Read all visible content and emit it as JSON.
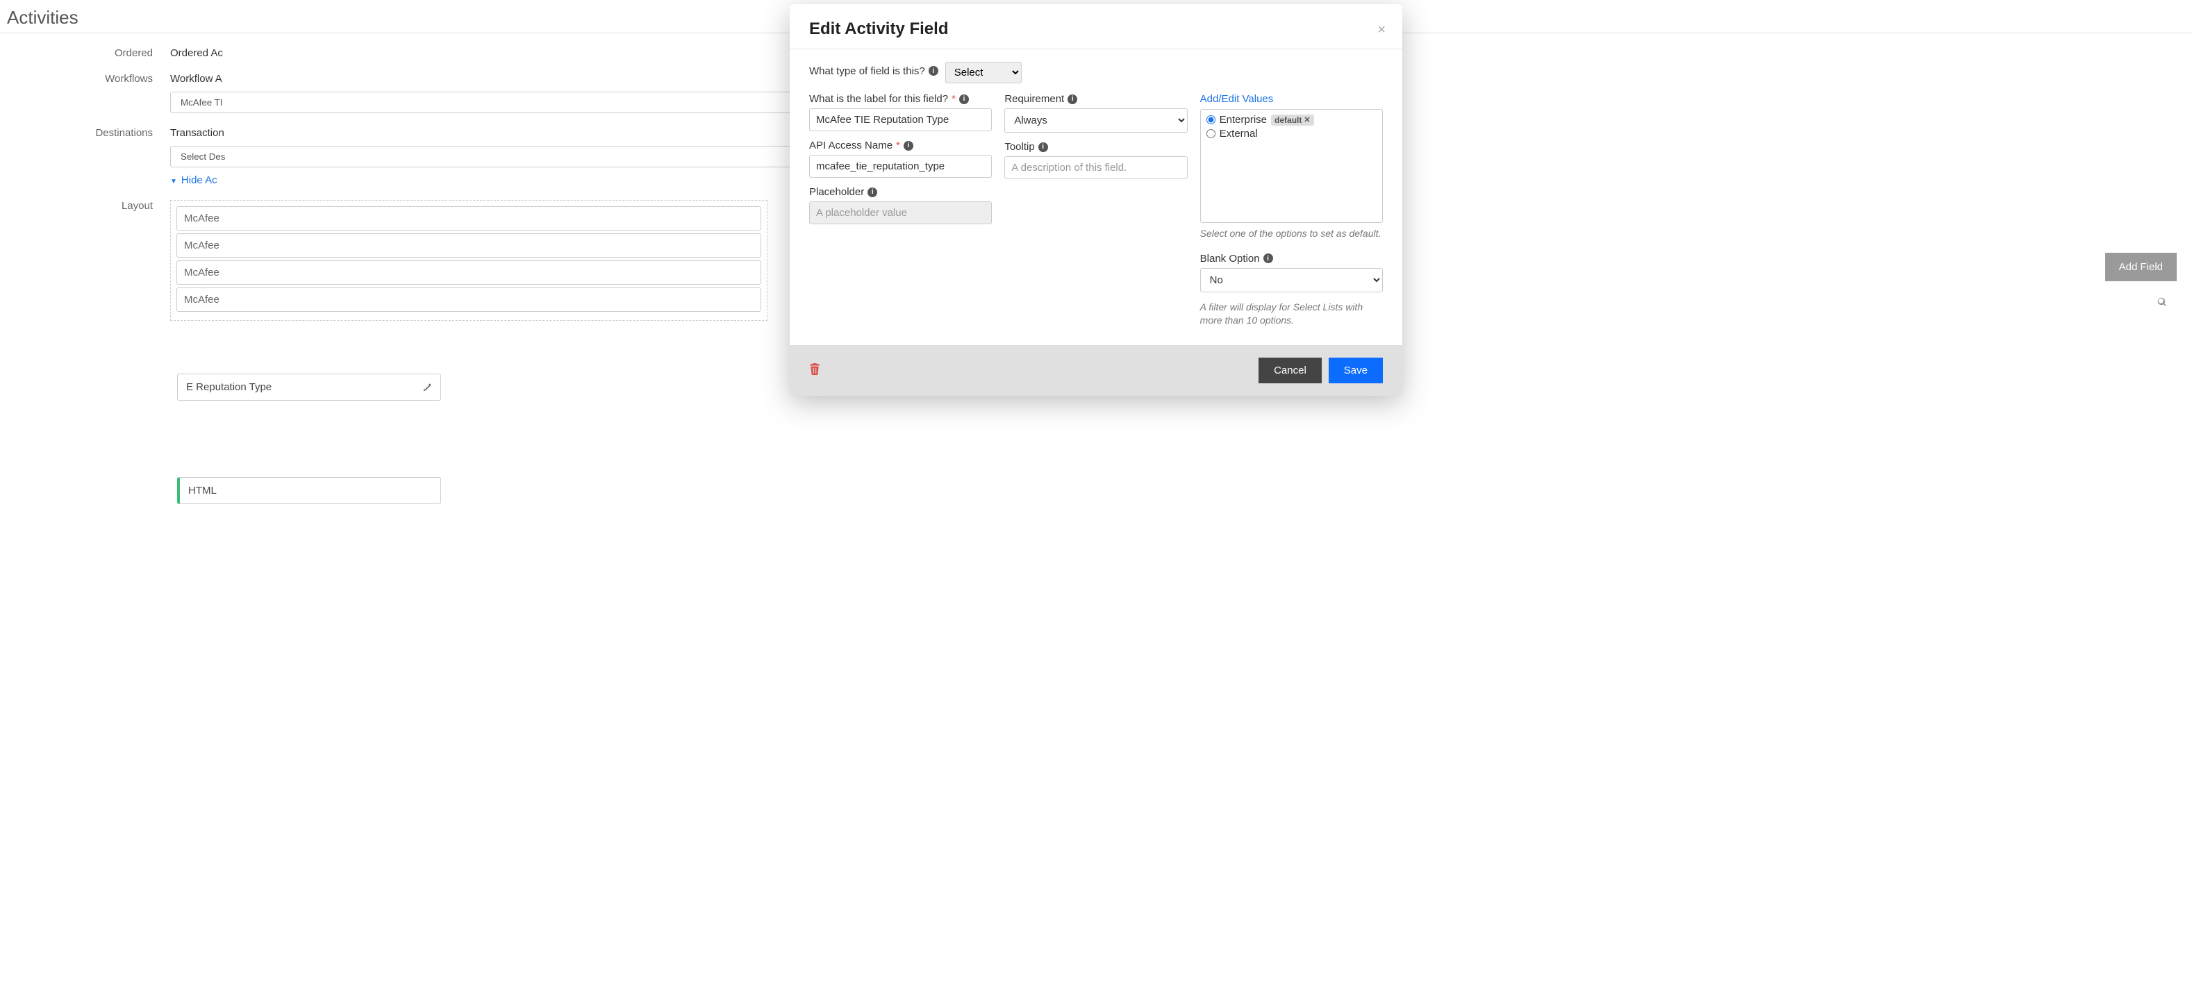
{
  "pageTitle": "Activities",
  "sidebar": {
    "ordered": "Ordered",
    "workflows": "Workflows",
    "destinations": "Destinations",
    "layout": "Layout"
  },
  "bg": {
    "orderedLabel": "Ordered Ac",
    "workflowLabel": "Workflow A",
    "select1": "McAfee TI",
    "destinationsRow": "Transaction",
    "select2": "Select Des",
    "hideLink": "Hide Ac",
    "addFieldBtn": "Add Field",
    "layoutRows": [
      "McAfee",
      "McAfee",
      "McAfee",
      "McAfee"
    ],
    "rightChip": "E Reputation Type",
    "htmlChip": "HTML"
  },
  "modal": {
    "title": "Edit Activity Field",
    "fieldTypeLabel": "What type of field is this?",
    "fieldTypeValue": "Select",
    "labelQuestion": "What is the label for this field?",
    "labelValue": "McAfee TIE Reputation Type",
    "apiNameLabel": "API Access Name",
    "apiNameValue": "mcafee_tie_reputation_type",
    "placeholderLabel": "Placeholder",
    "placeholderValue": "A placeholder value",
    "requirementLabel": "Requirement",
    "requirementValue": "Always",
    "tooltipLabel": "Tooltip",
    "tooltipPlaceholder": "A description of this field.",
    "addEditValues": "Add/Edit Values",
    "values": [
      {
        "label": "Enterprise",
        "selected": true,
        "default": true
      },
      {
        "label": "External",
        "selected": false,
        "default": false
      }
    ],
    "defaultTag": "default",
    "valuesHint": "Select one of the options to set as default.",
    "blankOptionLabel": "Blank Option",
    "blankOptionValue": "No",
    "blankOptionHint": "A filter will display for Select Lists with more than 10 options.",
    "cancel": "Cancel",
    "save": "Save"
  }
}
